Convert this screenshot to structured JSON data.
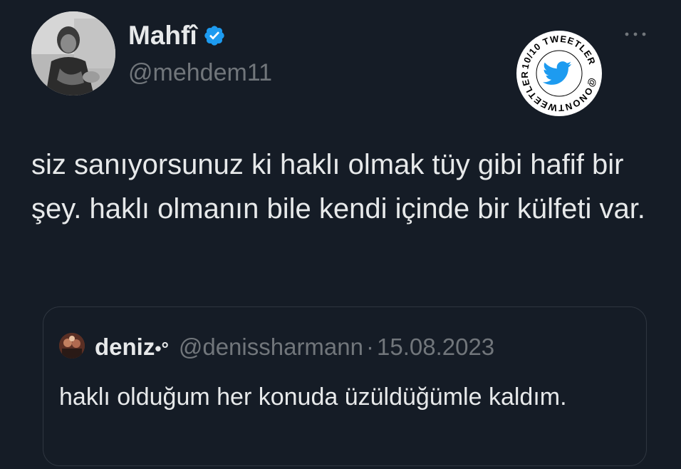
{
  "author": {
    "name": "Mahfî",
    "handle": "@mehdem11",
    "verified": true
  },
  "stamp": {
    "top_text": "10/10 TWEETLER",
    "bottom_text": "@ONONTWEETLER",
    "icon": "bird-icon",
    "color": "#1d9bf0"
  },
  "tweet": {
    "text": "siz sanıyorsunuz ki haklı olmak tüy gibi hafif bir şey. haklı olmanın bile kendi içinde bir külfeti var."
  },
  "quote": {
    "name": "deniz",
    "name_suffix": "•°",
    "handle": "@denissharmann",
    "separator": "·",
    "date": "15.08.2023",
    "text": "haklı olduğum her konuda üzüldüğümle kaldım."
  },
  "colors": {
    "background": "#151c26",
    "text": "#e7e9ea",
    "muted": "#71767b",
    "verified": "#1d9bf0",
    "border": "#2f3640"
  },
  "icons": {
    "verified": "verified-badge-icon",
    "more": "more-horizontal-icon"
  }
}
